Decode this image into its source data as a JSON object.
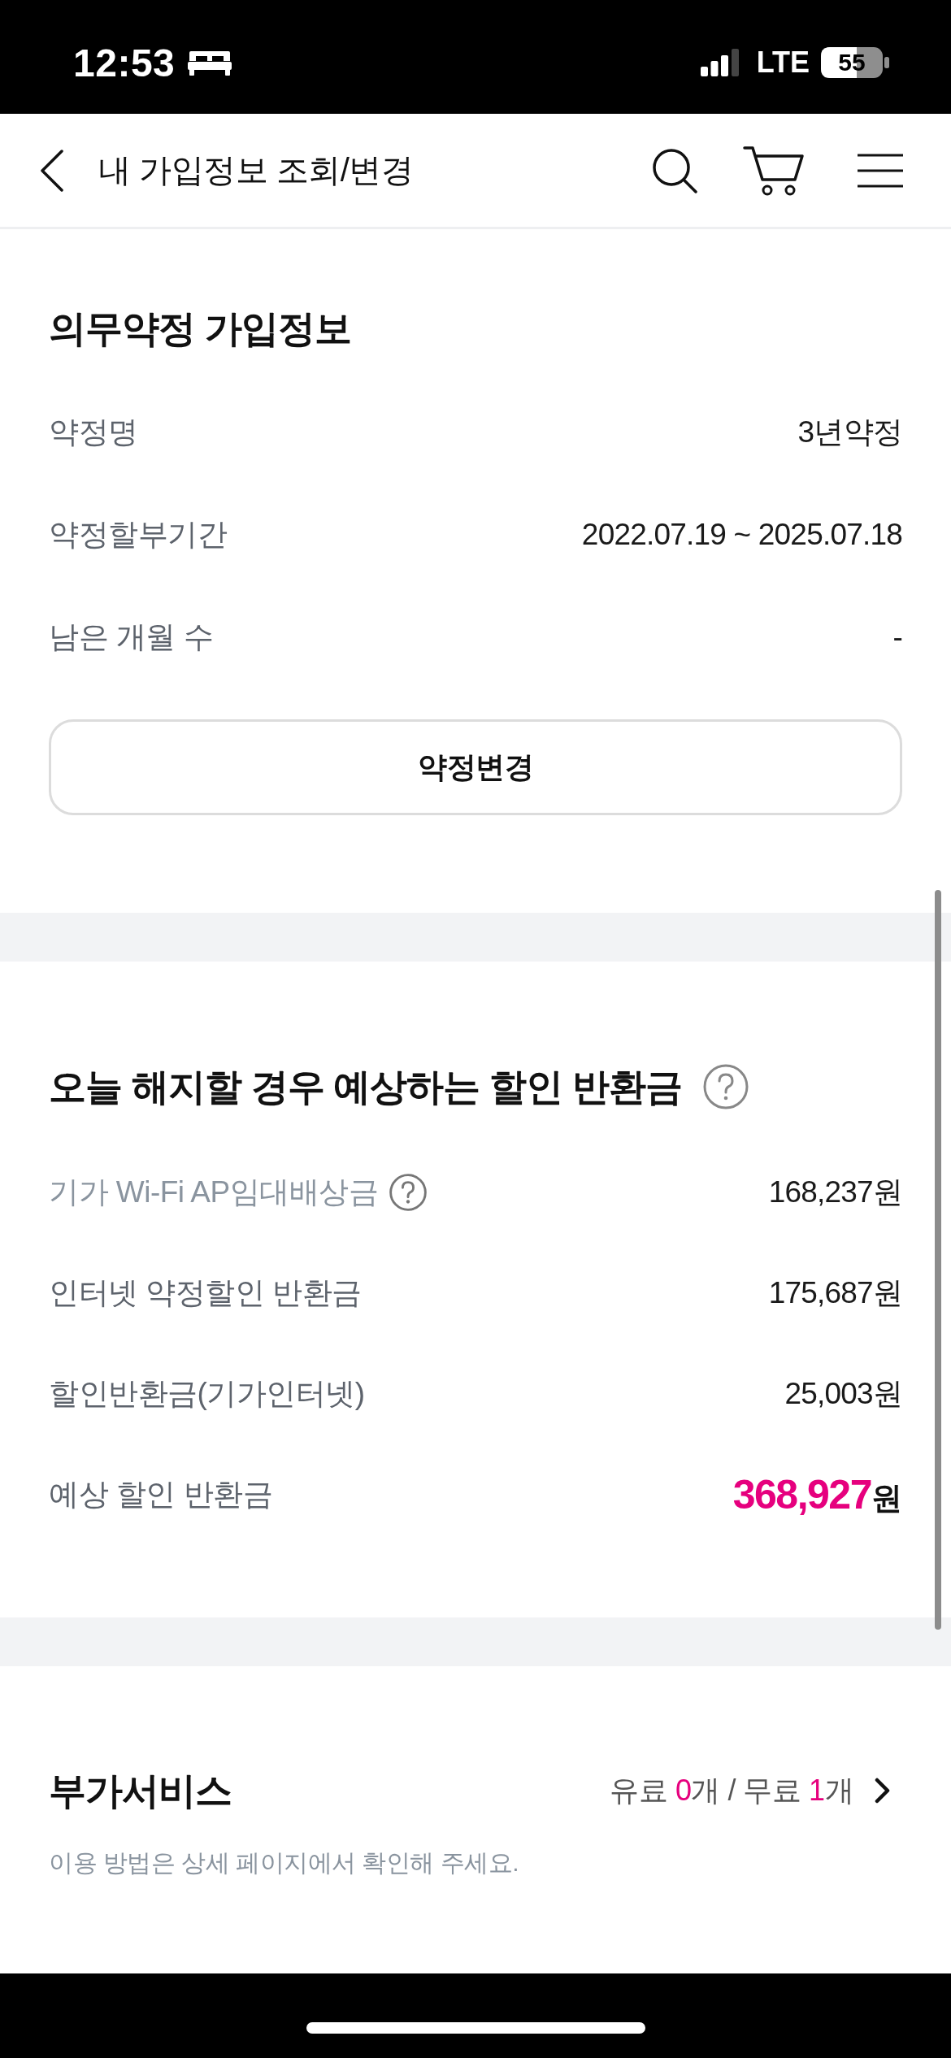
{
  "status_bar": {
    "time": "12:53",
    "network": "LTE",
    "battery": "55"
  },
  "header": {
    "title": "내 가입정보 조회/변경"
  },
  "contract": {
    "title": "의무약정 가입정보",
    "rows": [
      {
        "label": "약정명",
        "value": "3년약정"
      },
      {
        "label": "약정할부기간",
        "value": "2022.07.19 ~ 2025.07.18"
      },
      {
        "label": "남은 개월 수",
        "value": "-"
      }
    ],
    "button": "약정변경"
  },
  "refund": {
    "title": "오늘 해지할 경우 예상하는 할인 반환금",
    "rows": [
      {
        "kind": "info",
        "label": "기가 Wi-Fi AP임대배상금",
        "value": "168,237원"
      },
      {
        "kind": "plain",
        "label": "인터넷 약정할인 반환금",
        "value": "175,687원"
      },
      {
        "kind": "plain",
        "label": "할인반환금(기가인터넷)",
        "value": "25,003원"
      },
      {
        "kind": "total",
        "label": "예상 할인 반환금",
        "amount": "368,927",
        "unit": "원"
      }
    ]
  },
  "addons": {
    "title": "부가서비스",
    "summary": [
      {
        "text": "유료 ",
        "highlight": false
      },
      {
        "text": "0",
        "highlight": true
      },
      {
        "text": "개 / 무료 ",
        "highlight": false
      },
      {
        "text": "1",
        "highlight": true
      },
      {
        "text": "개",
        "highlight": false
      }
    ],
    "note": "이용 방법은 상세 페이지에서 확인해 주세요."
  }
}
